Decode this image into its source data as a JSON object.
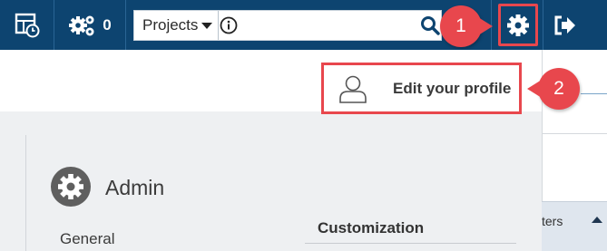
{
  "topbar": {
    "activity_count": "0",
    "search_scope": "Projects",
    "search_value": ""
  },
  "profile_menu": {
    "edit_profile_label": "Edit your profile"
  },
  "callouts": {
    "step1": "1",
    "step2": "2"
  },
  "admin": {
    "title": "Admin",
    "general_label": "General",
    "customization_label": "Customization"
  },
  "filters": {
    "label": "ters"
  },
  "icons": {
    "dashboard": "dashboard-clock-icon",
    "activity": "gears-icon",
    "info": "info-icon",
    "search": "search-icon",
    "settings": "gear-icon",
    "logout": "logout-icon",
    "user": "user-outline-icon",
    "admin": "admin-gear-icon"
  },
  "colors": {
    "nav_background": "#0d4470",
    "highlight": "#e8474d",
    "content_gray": "#eef0f2"
  }
}
